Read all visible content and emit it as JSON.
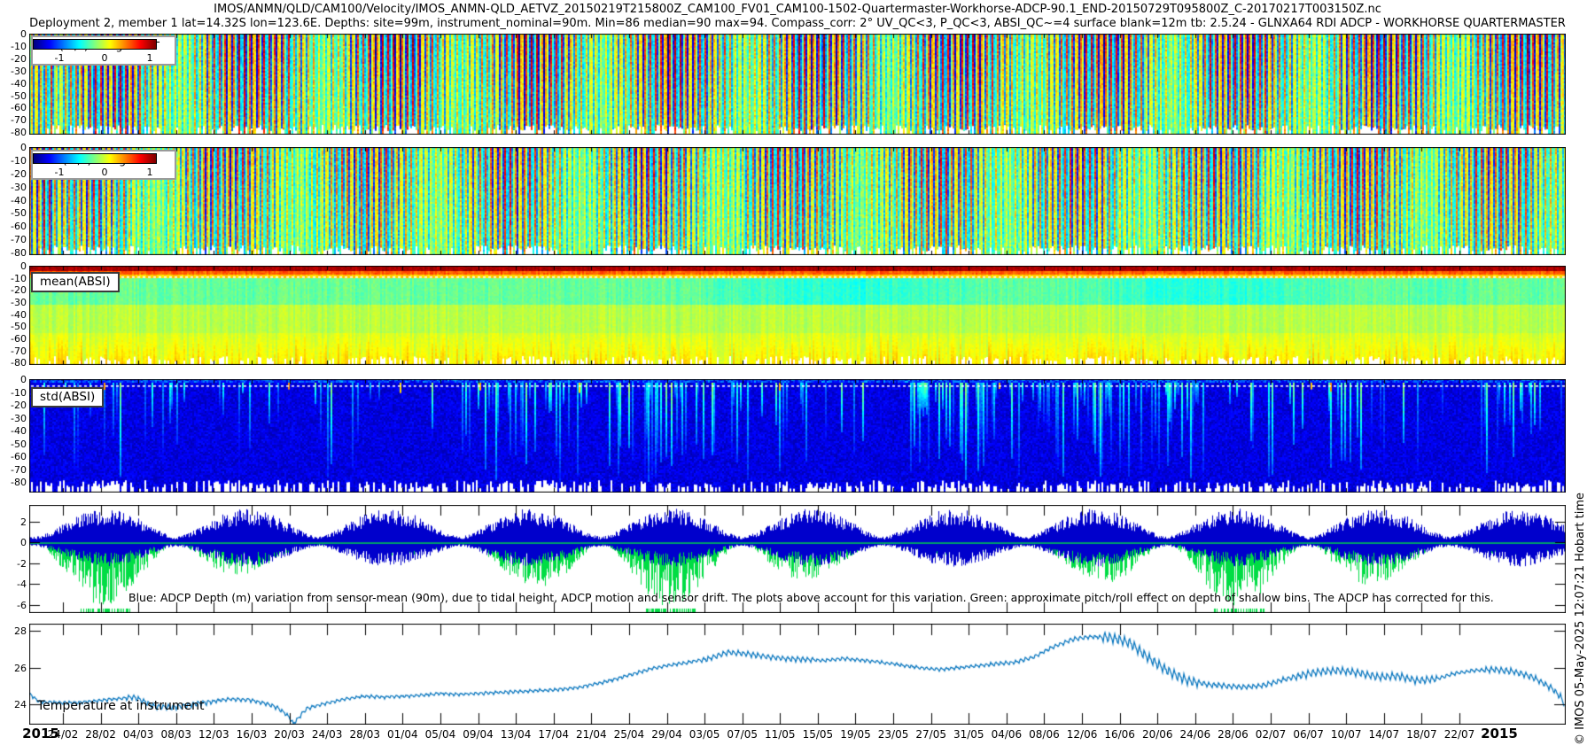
{
  "header": {
    "title_line1": "IMOS/ANMN/QLD/CAM100/Velocity/IMOS_ANMN-QLD_AETVZ_20150219T215800Z_CAM100_FV01_CAM100-1502-Quartermaster-Workhorse-ADCP-90.1_END-20150729T095800Z_C-20170217T003150Z.nc",
    "title_line2": "Deployment 2, member 1 lat=14.32S lon=123.6E. Depths: site=99m, instrument_nominal=90m. Min=86 median=90 max=94. Compass_corr: 2° UV_QC<3, P_QC<3, ABSI_QC~=4 surface blank=12m tb: 2.5.24 - GLNXA64 RDI ADCP - WORKHORSE QUARTERMASTER"
  },
  "watermark": "© IMOS 05-May-2025 12:07:21 Hobart time",
  "y_axis": {
    "depth_ticks": [
      "0",
      "-10",
      "-20",
      "-30",
      "-40",
      "-50",
      "-60",
      "-70",
      "-80"
    ]
  },
  "panels": {
    "u": {
      "legend_title": "U (m/s) along 172°T",
      "colorbar_ticks": [
        "-1",
        "0",
        "1"
      ]
    },
    "v": {
      "legend_title": "V (m/s) along 82°T",
      "colorbar_ticks": [
        "-1",
        "0",
        "1"
      ]
    },
    "mean_absi": {
      "label": "mean(ABSI)"
    },
    "std_absi": {
      "label": "std(ABSI)"
    },
    "depth": {
      "y_ticks": [
        "2",
        "0",
        "-2",
        "-4",
        "-6"
      ],
      "annotation": "Blue: ADCP Depth (m) variation from sensor-mean (90m), due to tidal height, ADCP motion and sensor drift. The plots above account for this variation. Green: approximate pitch/roll effect on depth of shallow bins. The ADCP has corrected for this."
    },
    "temperature": {
      "label": "Temperature at instrument",
      "y_ticks": [
        "24",
        "26",
        "28"
      ]
    }
  },
  "x_axis": {
    "year_left": "2015",
    "year_right": "2015",
    "tick_labels": [
      "24/02",
      "28/02",
      "04/03",
      "08/03",
      "12/03",
      "16/03",
      "20/03",
      "24/03",
      "28/03",
      "01/04",
      "05/04",
      "09/04",
      "13/04",
      "17/04",
      "21/04",
      "25/04",
      "29/04",
      "03/05",
      "07/05",
      "11/05",
      "15/05",
      "19/05",
      "23/05",
      "27/05",
      "31/05",
      "04/06",
      "08/06",
      "12/06",
      "16/06",
      "20/06",
      "24/06",
      "28/06",
      "02/07",
      "06/07",
      "10/07",
      "14/07",
      "18/07",
      "22/07"
    ]
  },
  "chart_data": [
    {
      "id": "u_velocity",
      "type": "heatmap",
      "title": "U (m/s) along 172°T",
      "value_range": [
        -1,
        1
      ],
      "depth_range_m": [
        0,
        -82
      ],
      "time_span_days": 160.5,
      "colormap": "jet",
      "tidal_period_days": 0.5175,
      "spring_neap_period_days": 14.77,
      "amp_base": 0.28,
      "amp_spring": 0.62,
      "env_phase_days": 1.0,
      "phase": 0.0,
      "description": "Vertical semidiurnal tidal striping; mostly green (|U|<0.3) alternating cyan/yellow, with spring-tide bursts saturating to dark blue/dark red columns; white data-dropout comb along the bottom bins."
    },
    {
      "id": "v_velocity",
      "type": "heatmap",
      "title": "V (m/s) along 82°T",
      "value_range": [
        -1,
        1
      ],
      "depth_range_m": [
        0,
        -82
      ],
      "time_span_days": 160.5,
      "colormap": "jet",
      "tidal_period_days": 0.5175,
      "spring_neap_period_days": 14.77,
      "amp_base": 0.24,
      "amp_spring": 0.52,
      "env_phase_days": -1.6,
      "phase": 2.1,
      "description": "Similar tidal striping to U but slightly weaker; predominantly green with cyan/yellow alternation and occasional saturated spring columns."
    },
    {
      "id": "mean_absi",
      "type": "heatmap",
      "label": "mean(ABSI)",
      "depth_range_m": [
        0,
        -82
      ],
      "time_span_days": 160.5,
      "colormap": "jet",
      "bands": [
        {
          "depth_m": [
            0,
            -4
          ],
          "appearance": "dark red band (strong surface echo)"
        },
        {
          "depth_m": [
            -4,
            -8
          ],
          "appearance": "orange-yellow band"
        },
        {
          "depth_m": [
            -8,
            -9
          ],
          "appearance": "white dotted marker line"
        },
        {
          "depth_m": [
            -9,
            -32
          ],
          "appearance": "cyan/turquoise, bluer patches mid-to-late deployment"
        },
        {
          "depth_m": [
            -32,
            -55
          ],
          "appearance": "green"
        },
        {
          "depth_m": [
            -55,
            -82
          ],
          "appearance": "green with yellow vertical streaks near bottom"
        }
      ]
    },
    {
      "id": "std_absi",
      "type": "heatmap",
      "label": "std(ABSI)",
      "depth_range_m": [
        0,
        -88
      ],
      "time_span_days": 160.5,
      "colormap": "jet",
      "description": "Dark navy background with lighter blue vertical streaks; scattered cyan-to-green high-variability columns hanging from the surface, densest mid-deployment; white dotted line near -5 m; white dropout comb along bottom bins."
    },
    {
      "id": "depth_variation",
      "type": "line",
      "ylim": [
        -6.8,
        3.6
      ],
      "y_ticks": [
        2,
        0,
        -2,
        -4,
        -6
      ],
      "time_span_days": 160.5,
      "tidal_period_days": 0.5175,
      "spring_neap_period_days": 14.77,
      "series": [
        {
          "name": "ADCP depth variation from sensor-mean (90m)",
          "color": "#0000cc",
          "behavior": "semidiurnal oscillation, spring-neap modulated, peaks +3 m to about -2.5 m"
        },
        {
          "name": "approximate pitch/roll effect on depth of shallow bins",
          "color": "#00dd44",
          "behavior": "hugs 0 with downward spring-tide excursions reaching -4 to -6.5 m"
        }
      ]
    },
    {
      "id": "temperature",
      "type": "line",
      "label": "Temperature at instrument",
      "ylim": [
        22.9,
        28.4
      ],
      "y_ticks": [
        24,
        26,
        28
      ],
      "color": "#0072bd",
      "time_span_days": 160.5,
      "x_days": [
        0,
        1,
        3,
        5,
        7,
        9,
        11,
        13,
        15,
        17,
        19,
        21,
        23,
        25,
        26,
        27,
        27.6,
        28.5,
        29,
        31,
        33,
        35,
        37,
        39,
        41,
        43,
        45,
        47,
        49,
        51,
        53,
        55,
        57,
        59,
        61,
        63,
        65,
        67,
        69,
        71,
        73,
        75,
        77,
        79,
        81,
        83,
        85,
        87,
        89,
        91,
        93,
        95,
        97,
        99,
        101,
        103,
        105,
        107,
        109,
        111,
        113,
        115,
        117,
        119,
        121,
        123,
        125,
        127,
        129,
        131,
        133,
        135,
        137,
        139,
        141,
        143,
        145,
        147,
        149,
        151,
        153,
        155,
        157,
        159,
        160,
        160.5
      ],
      "values_degC": [
        24.6,
        24.15,
        24.1,
        24.1,
        24.2,
        24.3,
        24.4,
        23.9,
        23.85,
        24.0,
        24.15,
        24.3,
        24.25,
        24.0,
        23.8,
        23.4,
        22.95,
        23.5,
        23.8,
        24.05,
        24.3,
        24.45,
        24.4,
        24.45,
        24.5,
        24.6,
        24.55,
        24.6,
        24.65,
        24.7,
        24.75,
        24.8,
        24.9,
        25.1,
        25.35,
        25.65,
        25.95,
        26.15,
        26.3,
        26.5,
        26.85,
        26.75,
        26.6,
        26.5,
        26.45,
        26.4,
        26.5,
        26.4,
        26.3,
        26.15,
        26.0,
        25.9,
        26.0,
        26.1,
        26.2,
        26.3,
        26.6,
        27.15,
        27.55,
        27.7,
        27.65,
        27.35,
        26.5,
        25.8,
        25.3,
        25.1,
        25.0,
        24.95,
        25.05,
        25.35,
        25.6,
        25.8,
        25.85,
        25.7,
        25.5,
        25.55,
        25.3,
        25.4,
        25.7,
        25.85,
        25.9,
        25.8,
        25.5,
        24.9,
        24.4,
        23.85
      ],
      "wiggle_bands": [
        [
          0,
          10,
          0.1
        ],
        [
          10,
          19,
          0.18
        ],
        [
          19,
          30,
          0.12
        ],
        [
          30,
          55,
          0.1
        ],
        [
          55,
          70,
          0.1
        ],
        [
          70,
          82,
          0.17
        ],
        [
          82,
          100,
          0.1
        ],
        [
          100,
          112,
          0.13
        ],
        [
          112,
          122,
          0.32
        ],
        [
          122,
          132,
          0.16
        ],
        [
          132,
          147,
          0.24
        ],
        [
          147,
          152,
          0.12
        ],
        [
          152,
          160.5,
          0.2
        ]
      ]
    }
  ]
}
